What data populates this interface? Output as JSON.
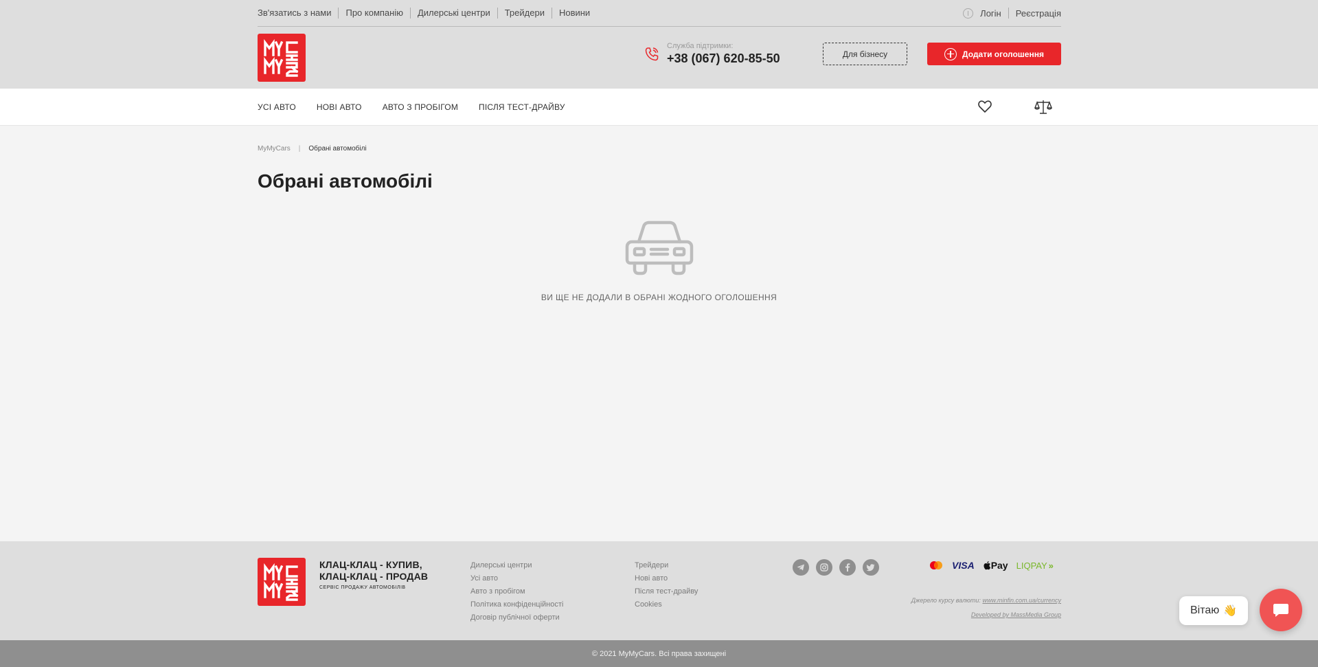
{
  "topbar": {
    "links": [
      "Зв'язатись з нами",
      "Про компанію",
      "Дилерські центри",
      "Трейдери",
      "Новини"
    ],
    "login": "Логін",
    "register": "Реєстрація"
  },
  "header": {
    "logo_alt": "MyMyCars",
    "support_label": "Служба підтримки:",
    "support_phone": "+38 (067) 620-85-50",
    "business_button": "Для бізнесу",
    "add_button": "Додати оголошення"
  },
  "nav": {
    "items": [
      "УСІ АВТО",
      "НОВІ АВТО",
      "АВТО З ПРОБІГОМ",
      "ПІСЛЯ ТЕСТ-ДРАЙВУ"
    ],
    "icons": [
      "heart-icon",
      "scales-icon"
    ]
  },
  "breadcrumbs": {
    "home": "MyMyCars",
    "separator": "|",
    "current": "Обрані автомобілі"
  },
  "page": {
    "title": "Обрані автомобілі",
    "empty_message": "ВИ ЩЕ НЕ ДОДАЛИ В ОБРАНІ ЖОДНОГО ОГОЛОШЕННЯ"
  },
  "footer": {
    "slogan_line1": "КЛАЦ-КЛАЦ - КУПИВ,",
    "slogan_line2": "КЛАЦ-КЛАЦ - ПРОДАВ",
    "slogan_sub": "СЕРВІС ПРОДАЖУ АВТОМОБІЛІВ",
    "col1": [
      "Дилерські центри",
      "Усі авто",
      "Авто з пробігом",
      "Політика конфіденційності",
      "Договір публічної оферти"
    ],
    "col2": [
      "Трейдери",
      "Нові авто",
      "Після тест-драйву",
      "Cookies"
    ],
    "socials": [
      "telegram-icon",
      "instagram-icon",
      "facebook-icon",
      "twitter-icon"
    ],
    "payments": [
      "mastercard",
      "VISA",
      "Pay",
      "LIQPAY"
    ],
    "currency_note": "Джерело курсу валюти:",
    "currency_link": "www.minfin.com.ua/currency",
    "developer": "Developed by MassMedia Group",
    "copyright": "© 2021 MyMyCars. Всі права захищені"
  },
  "chat": {
    "greeting": "Вітаю",
    "greeting_emoji": "👋"
  },
  "colors": {
    "brand_red": "#e8262a",
    "header_bg": "#dedede",
    "page_bg": "#f4f4f4",
    "copyright_bg": "#8f8f8f",
    "chat_button": "#f05454",
    "liqpay_green": "#7ab72b"
  }
}
